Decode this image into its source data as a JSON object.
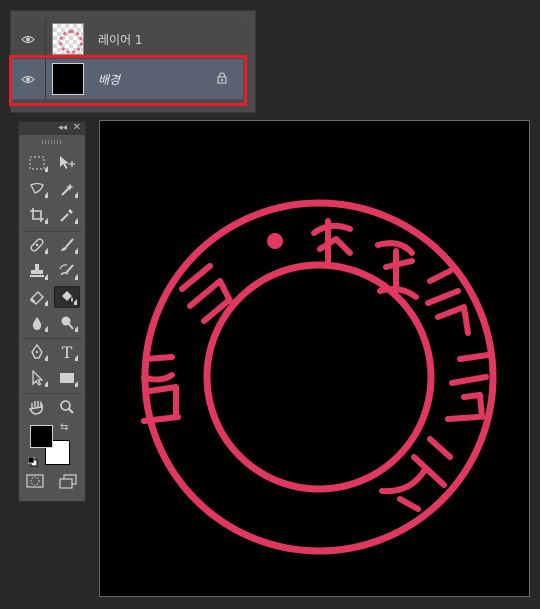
{
  "layers": [
    {
      "name": "레이어 1",
      "visible": true,
      "thumbnail": "transparent-checker-with-stamp",
      "selected": false
    },
    {
      "name": "배경",
      "visible": true,
      "thumbnail": "black-fill",
      "selected": true,
      "locked": true
    }
  ],
  "tools": [
    "rectangular-marquee",
    "move",
    "lasso",
    "magic-wand",
    "crop",
    "eyedropper",
    "spot-healing-brush",
    "brush",
    "clone-stamp",
    "history-brush",
    "eraser",
    "paint-bucket",
    "blur",
    "dodge",
    "pen",
    "type",
    "path-selection",
    "rectangle",
    "hand",
    "zoom"
  ],
  "active_tool": "paint-bucket",
  "type_tool_label": "T",
  "colors": {
    "foreground": "#000000",
    "background": "#ffffff",
    "highlight": "#e3202b",
    "stamp_ink": "#e0385e"
  },
  "canvas": {
    "background": "#000000",
    "content": "circular red seal stamp"
  }
}
